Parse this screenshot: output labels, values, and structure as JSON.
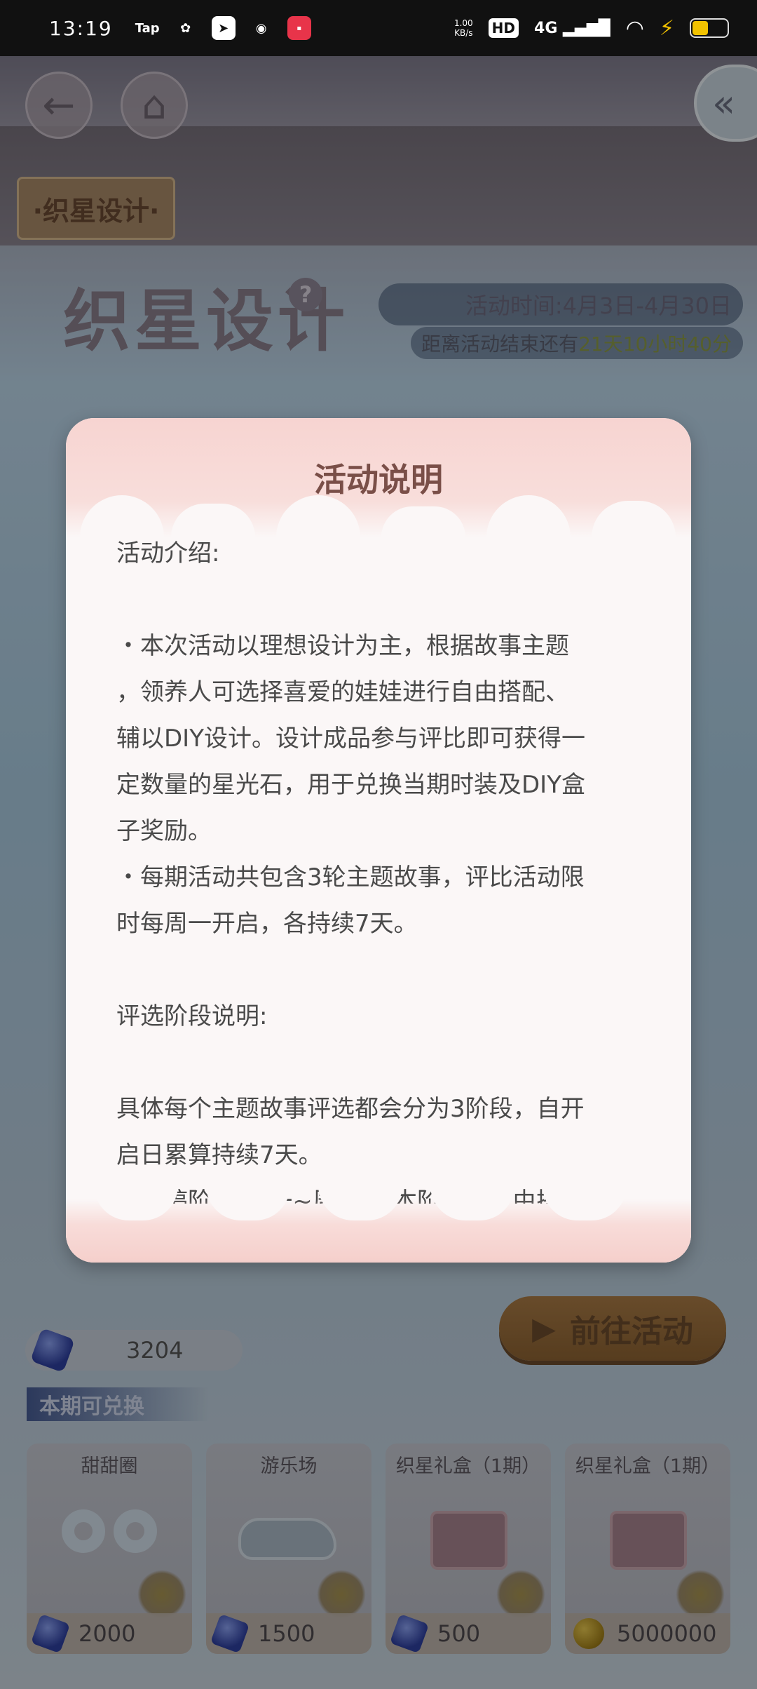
{
  "status_bar": {
    "time": "13:19",
    "app_icons": [
      "Tap",
      "pinwheel-icon",
      "send-icon",
      "weibo-icon",
      "xiaohongshu-icon"
    ],
    "net_speed": "1.00\nKB/s",
    "hd": "HD",
    "signal": "4G"
  },
  "game": {
    "tab": "·织星设计·",
    "title": "织星设计",
    "help": "?",
    "event_time": "活动时间:4月3日-4月30日",
    "countdown_prefix": "距离活动结束还有",
    "countdown_value": "21天10小时40分",
    "go_button": "前往活动",
    "currency_amount": "3204",
    "exchange_label": "本期可兑换",
    "items": [
      {
        "name": "甜甜圈",
        "price": "2000",
        "currency": "gem"
      },
      {
        "name": "游乐场",
        "price": "1500",
        "currency": "gem"
      },
      {
        "name": "织星礼盒（1期）",
        "price": "500",
        "currency": "gem"
      },
      {
        "name": "织星礼盒（1期）",
        "price": "5000000",
        "currency": "coin"
      }
    ]
  },
  "modal": {
    "title": "活动说明",
    "lines": [
      "活动介绍:",
      "",
      "・本次活动以理想设计为主，根据故事主题",
      "，领养人可选择喜爱的娃娃进行自由搭配、",
      "辅以DIY设计。设计成品参与评比即可获得一",
      "定数量的星光石，用于兑换当期时装及DIY盒",
      "子奖励。",
      "・每期活动共包含3轮主题故事，评比活动限",
      "时每周一开启，各持续7天。",
      "",
      "评选阶段说明:",
      "",
      "具体每个主题故事评选都会分为3阶段，自开",
      "启日累算持续7天。",
      "・投稿阶段(周一~周四)：本阶段主自由搭配"
    ]
  }
}
